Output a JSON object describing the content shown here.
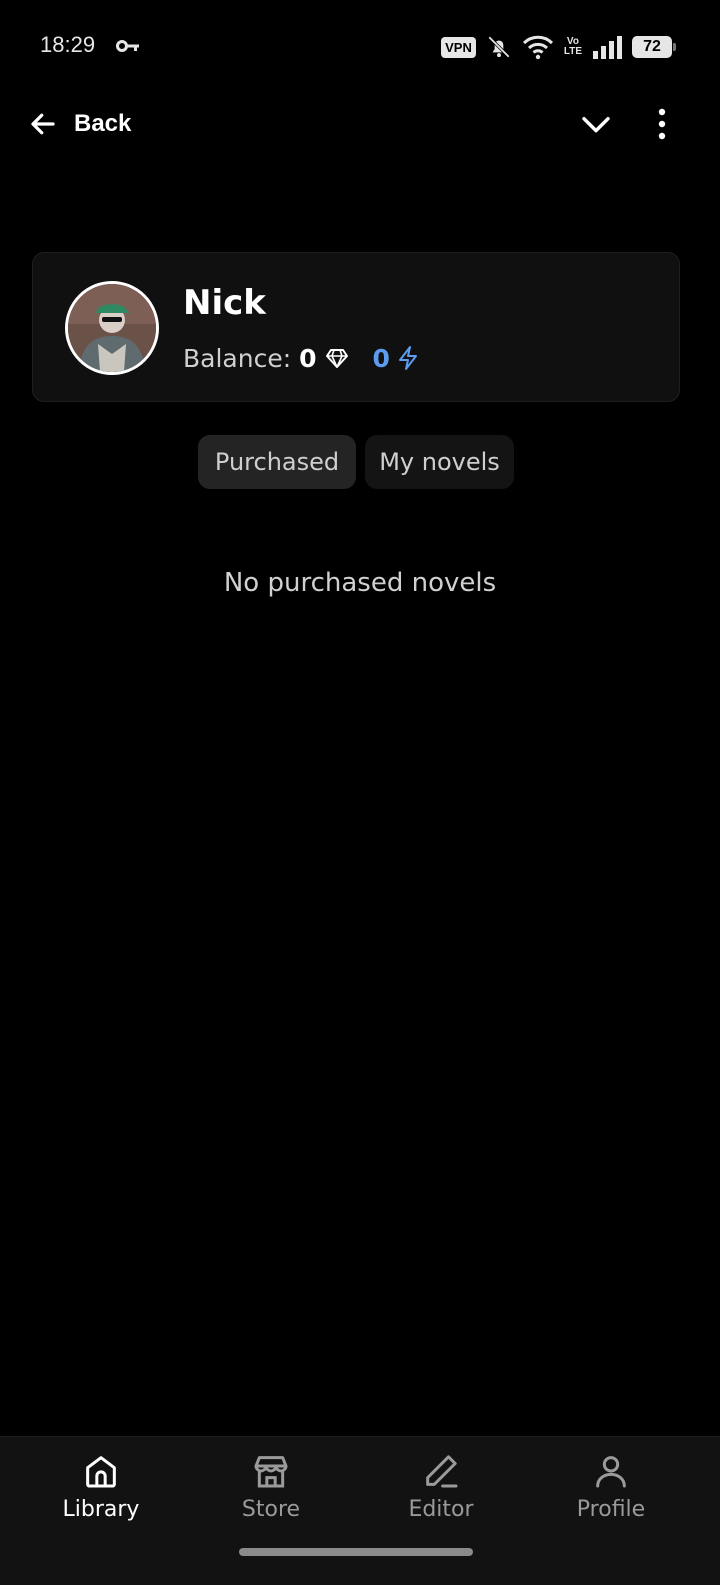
{
  "status_bar": {
    "time": "18:29",
    "vpn_label": "VPN",
    "volte_top": "Vo",
    "volte_bottom": "LTE",
    "battery": "72",
    "icons": [
      "key-icon",
      "bell-off-icon",
      "wifi-icon",
      "signal-icon",
      "battery-icon"
    ]
  },
  "header": {
    "back_label": "Back",
    "icons": [
      "arrow-left-icon",
      "chevron-down-icon",
      "more-vertical-icon"
    ]
  },
  "profile": {
    "name": "Nick",
    "balance_label": "Balance:",
    "gems": "0",
    "energy": "0",
    "energy_color": "#5b9bf0",
    "icons": [
      "diamond-icon",
      "lightning-icon"
    ]
  },
  "tabs": [
    {
      "label": "Purchased",
      "active": true
    },
    {
      "label": "My novels",
      "active": false
    }
  ],
  "empty_message": "No purchased novels",
  "bottom_nav": [
    {
      "label": "Library",
      "icon": "home-icon",
      "active": true
    },
    {
      "label": "Store",
      "icon": "store-icon",
      "active": false
    },
    {
      "label": "Editor",
      "icon": "pencil-icon",
      "active": false
    },
    {
      "label": "Profile",
      "icon": "user-icon",
      "active": false
    }
  ]
}
